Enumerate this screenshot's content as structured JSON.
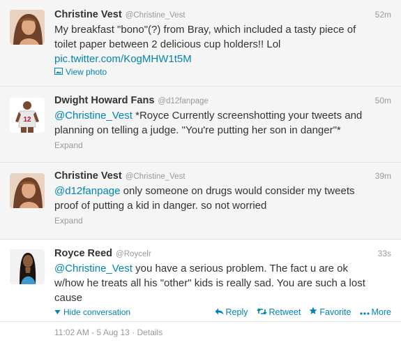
{
  "tweets": [
    {
      "fullname": "Christine Vest",
      "username": "@Christine_Vest",
      "time": "52m",
      "line1": "My breakfast \"bono\"(?) from Bray, which included a tasty piece of",
      "line2": "toilet paper between 2 delicious cup holders!! Lol",
      "link": "pic.twitter.com/KogMHW1t5M",
      "view_photo": "View photo"
    },
    {
      "fullname": "Dwight Howard Fans",
      "username": "@d12fanpage",
      "time": "50m",
      "mention": "@Christine_Vest",
      "line1_rest": " *Royce Currently screenshotting your tweets and",
      "line2": "planning on telling a judge. \"You're putting her son in danger\"*",
      "expand": "Expand"
    },
    {
      "fullname": "Christine Vest",
      "username": "@Christine_Vest",
      "time": "39m",
      "mention": "@d12fanpage",
      "line1_rest": " only someone on drugs would consider my tweets",
      "line2": "proof of putting a kid in danger. so not worried",
      "expand": "Expand"
    },
    {
      "fullname": "Royce Reed",
      "username": "@Roycelr",
      "time": "33s",
      "mention": "@Christine_Vest",
      "line1_rest": " you have a serious problem. The fact u are ok",
      "line2": "w/how he treats all his \"other\" kids is really sad. You are such a lost",
      "line3": "cause",
      "hide_conversation": "Hide conversation",
      "reply": "Reply",
      "retweet": "Retweet",
      "favorite": "Favorite",
      "more": "More",
      "timestamp": "11:02 AM - 5 Aug 13 · Details"
    }
  ],
  "colors": {
    "link": "#0084b4",
    "muted": "#999999",
    "text": "#333333",
    "collapsed_bg": "#f5f5f5"
  },
  "icons": {
    "photo": "photo-icon",
    "conversation": "conversation-icon",
    "reply": "reply-icon",
    "retweet": "retweet-icon",
    "favorite": "star-icon",
    "more": "more-dots-icon"
  }
}
